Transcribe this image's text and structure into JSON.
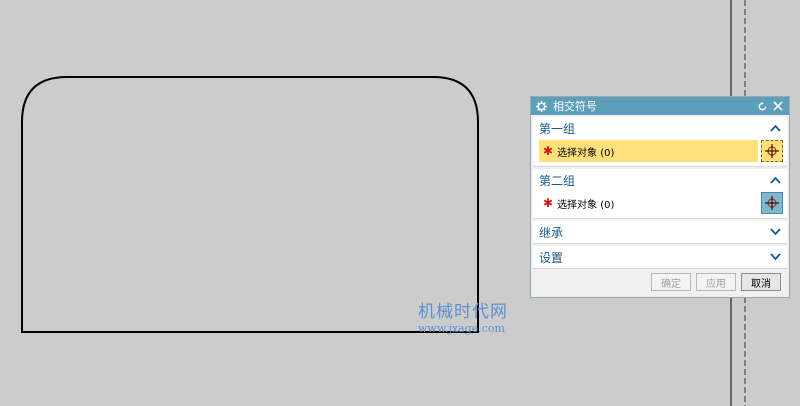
{
  "dialog": {
    "title": "相交符号",
    "sections": [
      {
        "label": "第一组",
        "state": "expanded",
        "select_label": "选择对象 (0)",
        "active": true
      },
      {
        "label": "第二组",
        "state": "expanded",
        "select_label": "选择对象 (0)",
        "active": false
      },
      {
        "label": "继承",
        "state": "collapsed"
      },
      {
        "label": "设置",
        "state": "collapsed"
      }
    ],
    "required_marker": "✱",
    "buttons": {
      "ok": "确定",
      "apply": "应用",
      "cancel": "取消"
    }
  },
  "watermark": {
    "text": "机械时代网",
    "url": "www.jxage.com"
  },
  "colors": {
    "canvas_bg": "#cccccc",
    "title_bar": "#5d9fb8",
    "section_header_text": "#1a5a8a",
    "active_highlight": "#ffe07a",
    "watermark": "#5b8fd0"
  },
  "icons": {
    "title": "gear-icon",
    "reset": "reset-icon",
    "close": "close-icon",
    "expand": "chevron-up-icon",
    "collapse": "chevron-down-icon",
    "pick": "crosshair-icon"
  }
}
